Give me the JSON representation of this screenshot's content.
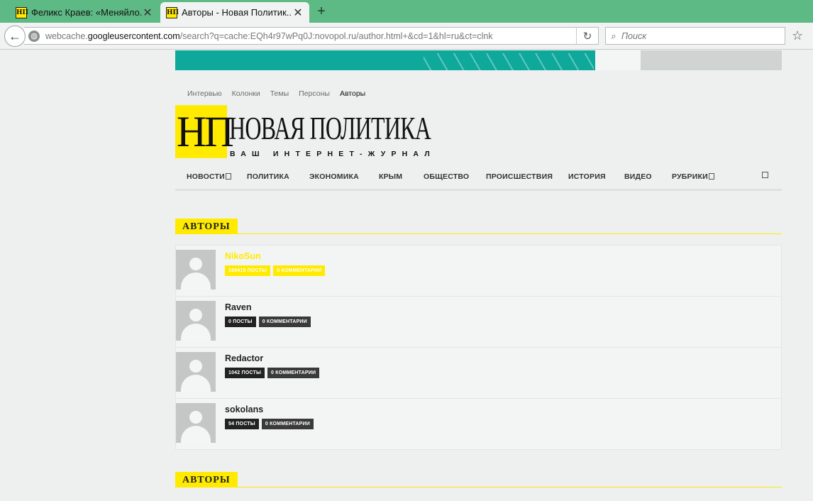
{
  "browser": {
    "tabs": [
      {
        "title": "Феликс Краев: «Меняйло...",
        "favicon": "НП",
        "active": false
      },
      {
        "title": "Авторы - Новая Политик...",
        "favicon": "НП",
        "active": true
      }
    ],
    "url_prefix": "webcache.",
    "url_host": "googleusercontent.com",
    "url_rest": "/search?q=cache:EQh4r97wPq0J:novopol.ru/author.html+&cd=1&hl=ru&ct=clnk",
    "search_placeholder": "Поиск",
    "icons": {
      "back": "back-arrow-icon",
      "site": "globe-icon",
      "reload": "reload-icon",
      "search": "search-icon",
      "bookmark": "star-icon",
      "close": "close-icon",
      "new_tab": "plus-icon"
    }
  },
  "site": {
    "top_menu": [
      "Интервью",
      "Колонки",
      "Темы",
      "Персоны",
      "Авторы"
    ],
    "logo_mark": "НП",
    "logo_name": "НОВАЯ ПОЛИТИКА",
    "logo_tagline": "ВАШ ИНТЕРНЕТ-ЖУРНАЛ",
    "main_nav": [
      "НОВОСТИ",
      "ПОЛИТИКА",
      "ЭКОНОМИКА",
      "КРЫМ",
      "ОБЩЕСТВО",
      "ПРОИСШЕСТВИЯ",
      "ИСТОРИЯ",
      "ВИДЕО",
      "РУБРИКИ"
    ],
    "section_title": "АВТОРЫ",
    "section_title_bottom": "АВТОРЫ",
    "authors": [
      {
        "name": "NikoSun",
        "posts": "169415 ПОСТЫ",
        "comments": "0 КОММЕНТАРИИ"
      },
      {
        "name": "Raven",
        "posts": "0 ПОСТЫ",
        "comments": "0 КОММЕНТАРИИ"
      },
      {
        "name": "Redactor",
        "posts": "1042 ПОСТЫ",
        "comments": "0 КОММЕНТАРИИ"
      },
      {
        "name": "sokolans",
        "posts": "54 ПОСТЫ",
        "comments": "0 КОММЕНТАРИИ"
      }
    ],
    "colors": {
      "accent": "#ffea00",
      "tabbar": "#5dba85",
      "banner": "#0ea99a",
      "background": "#eef0ef"
    }
  }
}
